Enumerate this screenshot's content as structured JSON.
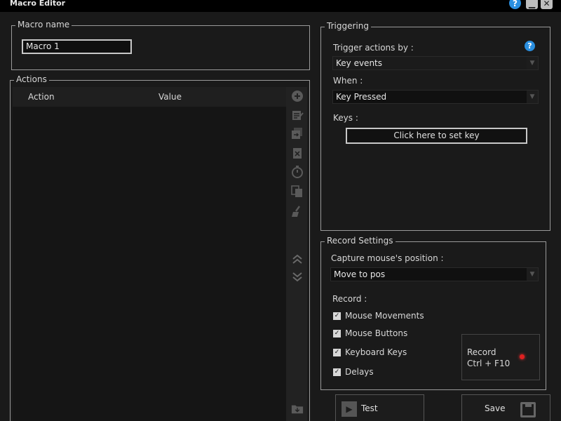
{
  "window": {
    "title": "Macro Editor"
  },
  "macro_name": {
    "legend": "Macro name",
    "value": "Macro 1"
  },
  "actions": {
    "legend": "Actions",
    "columns": [
      "Action",
      "Value"
    ]
  },
  "triggering": {
    "legend": "Triggering",
    "trigger_label": "Trigger actions by :",
    "trigger_value": "Key events",
    "when_label": "When :",
    "when_value": "Key Pressed",
    "keys_label": "Keys :",
    "set_key_button": "Click here to set key"
  },
  "record_settings": {
    "legend": "Record Settings",
    "capture_label": "Capture mouse's position :",
    "capture_value": "Move to pos",
    "record_label": "Record :",
    "options": [
      {
        "label": "Mouse Movements",
        "checked": true
      },
      {
        "label": "Mouse Buttons",
        "checked": true
      },
      {
        "label": "Keyboard Keys",
        "checked": true
      },
      {
        "label": "Delays",
        "checked": true
      }
    ],
    "record_button_line1": "Record",
    "record_button_line2": "Ctrl + F10"
  },
  "buttons": {
    "test": "Test",
    "save": "Save"
  },
  "colors": {
    "accent_blue": "#2a8fe0",
    "record_red": "#e02020",
    "background": "#1a1a1a"
  }
}
